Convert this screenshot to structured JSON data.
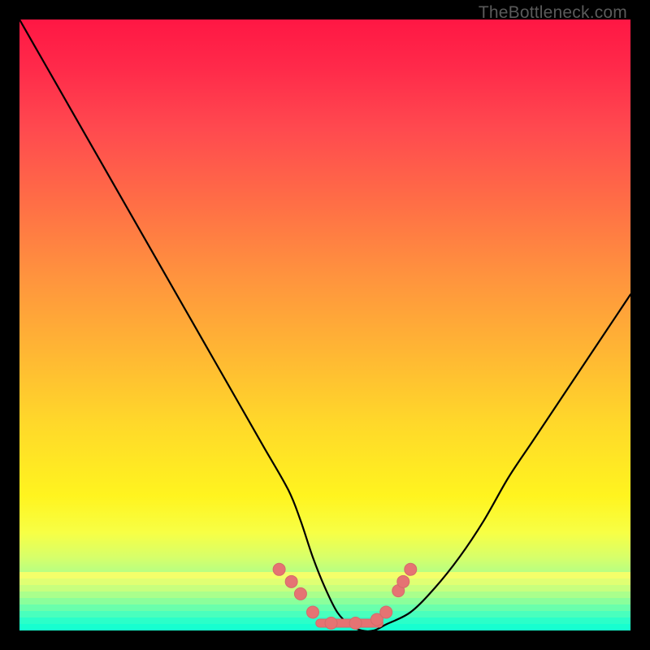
{
  "watermark": "TheBottleneck.com",
  "colors": {
    "curve": "#000000",
    "marker_fill": "#e57373",
    "marker_stroke": "#d46a6a",
    "gradient_top": "#ff1744",
    "gradient_bottom": "#17ffc9",
    "frame": "#000000"
  },
  "chart_data": {
    "type": "line",
    "title": "",
    "xlabel": "",
    "ylabel": "",
    "xlim": [
      0,
      100
    ],
    "ylim": [
      0,
      100
    ],
    "grid": false,
    "legend": false,
    "series": [
      {
        "name": "bottleneck-curve",
        "x": [
          0,
          4,
          8,
          12,
          16,
          20,
          24,
          28,
          32,
          36,
          40,
          44,
          46,
          48,
          50,
          52,
          54,
          56,
          58,
          60,
          64,
          68,
          72,
          76,
          80,
          84,
          88,
          92,
          96,
          100
        ],
        "y": [
          100,
          93,
          86,
          79,
          72,
          65,
          58,
          51,
          44,
          37,
          30,
          23,
          18,
          12,
          7,
          3,
          1,
          0,
          0,
          1,
          3,
          7,
          12,
          18,
          25,
          31,
          37,
          43,
          49,
          55
        ]
      }
    ],
    "markers": {
      "name": "threshold-dots",
      "x": [
        42.5,
        44.5,
        46.0,
        48.0,
        51.0,
        55.0,
        58.5,
        60.0,
        62.0,
        62.8,
        64.0
      ],
      "y": [
        10.0,
        8.0,
        6.0,
        3.0,
        1.2,
        1.2,
        1.8,
        3.0,
        6.5,
        8.0,
        10.0
      ]
    },
    "flat_bar": {
      "name": "optimal-range-bar",
      "x_start": 48.5,
      "x_end": 59.5,
      "y": 1.2
    },
    "green_bands": {
      "count": 9,
      "colors": [
        "#f4ff6a",
        "#e0ff73",
        "#c7ff7e",
        "#aaff8c",
        "#8bff9b",
        "#6affac",
        "#49ffbd",
        "#2bffc9",
        "#17ffd0"
      ]
    }
  }
}
